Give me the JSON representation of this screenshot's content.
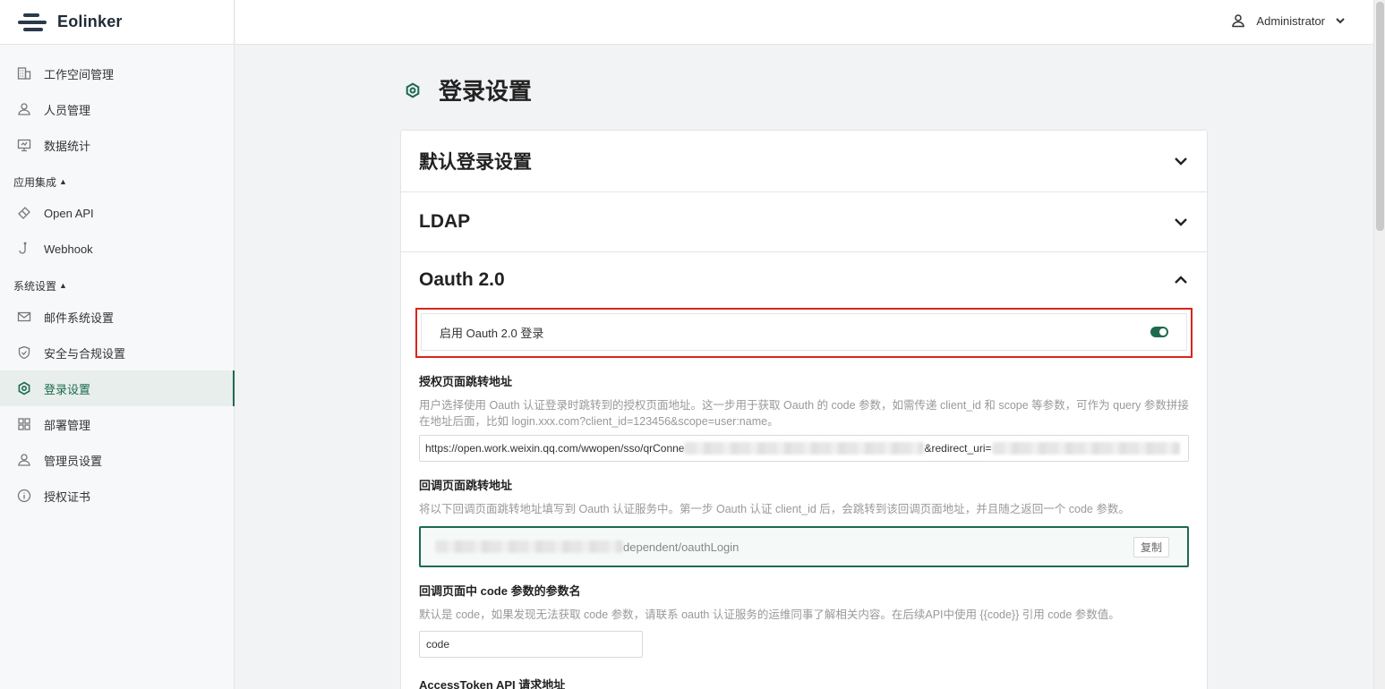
{
  "brand": {
    "name": "Eolinker"
  },
  "user": {
    "name": "Administrator"
  },
  "sidebar": {
    "items_top": [
      {
        "label": "工作空间管理",
        "icon": "building-icon"
      },
      {
        "label": "人员管理",
        "icon": "user-icon"
      },
      {
        "label": "数据统计",
        "icon": "monitor-icon"
      }
    ],
    "group_apps": "应用集成",
    "items_apps": [
      {
        "label": "Open API",
        "icon": "ticket-icon"
      },
      {
        "label": "Webhook",
        "icon": "hook-icon"
      }
    ],
    "group_system": "系统设置",
    "items_system": [
      {
        "label": "邮件系统设置",
        "icon": "mail-icon"
      },
      {
        "label": "安全与合规设置",
        "icon": "shield-icon"
      },
      {
        "label": "登录设置",
        "icon": "gear-icon",
        "active": true
      },
      {
        "label": "部署管理",
        "icon": "grid-icon"
      },
      {
        "label": "管理员设置",
        "icon": "user-icon"
      },
      {
        "label": "授权证书",
        "icon": "info-icon"
      }
    ]
  },
  "page": {
    "title": "登录设置"
  },
  "sections": {
    "default_login": "默认登录设置",
    "ldap": "LDAP",
    "oauth": "Oauth 2.0"
  },
  "oauth": {
    "enable_label": "启用 Oauth 2.0 登录",
    "enabled": true,
    "auth_url_label": "授权页面跳转地址",
    "auth_url_desc": "用户选择使用 Oauth 认证登录时跳转到的授权页面地址。这一步用于获取 Oauth 的 code 参数，如需传递 client_id 和 scope 等参数，可作为 query 参数拼接在地址后面，比如 login.xxx.com?client_id=123456&scope=user:name。",
    "auth_url_prefix": "https://open.work.weixin.qq.com/wwopen/sso/qrConne",
    "auth_url_mid": "&redirect_uri=",
    "callback_label": "回调页面跳转地址",
    "callback_desc": "将以下回调页面跳转地址填写到 Oauth 认证服务中。第一步 Oauth 认证 client_id 后，会跳转到该回调页面地址，并且随之返回一个 code 参数。",
    "callback_suffix": "dependent/oauthLogin",
    "copy_label": "复制",
    "code_param_label": "回调页面中 code 参数的参数名",
    "code_param_desc": "默认是 code，如果发现无法获取 code 参数，请联系 oauth 认证服务的运维同事了解相关内容。在后续API中使用 {{code}} 引用 code 参数值。",
    "code_param_value": "code",
    "next_label": "AccessToken API 请求地址"
  }
}
